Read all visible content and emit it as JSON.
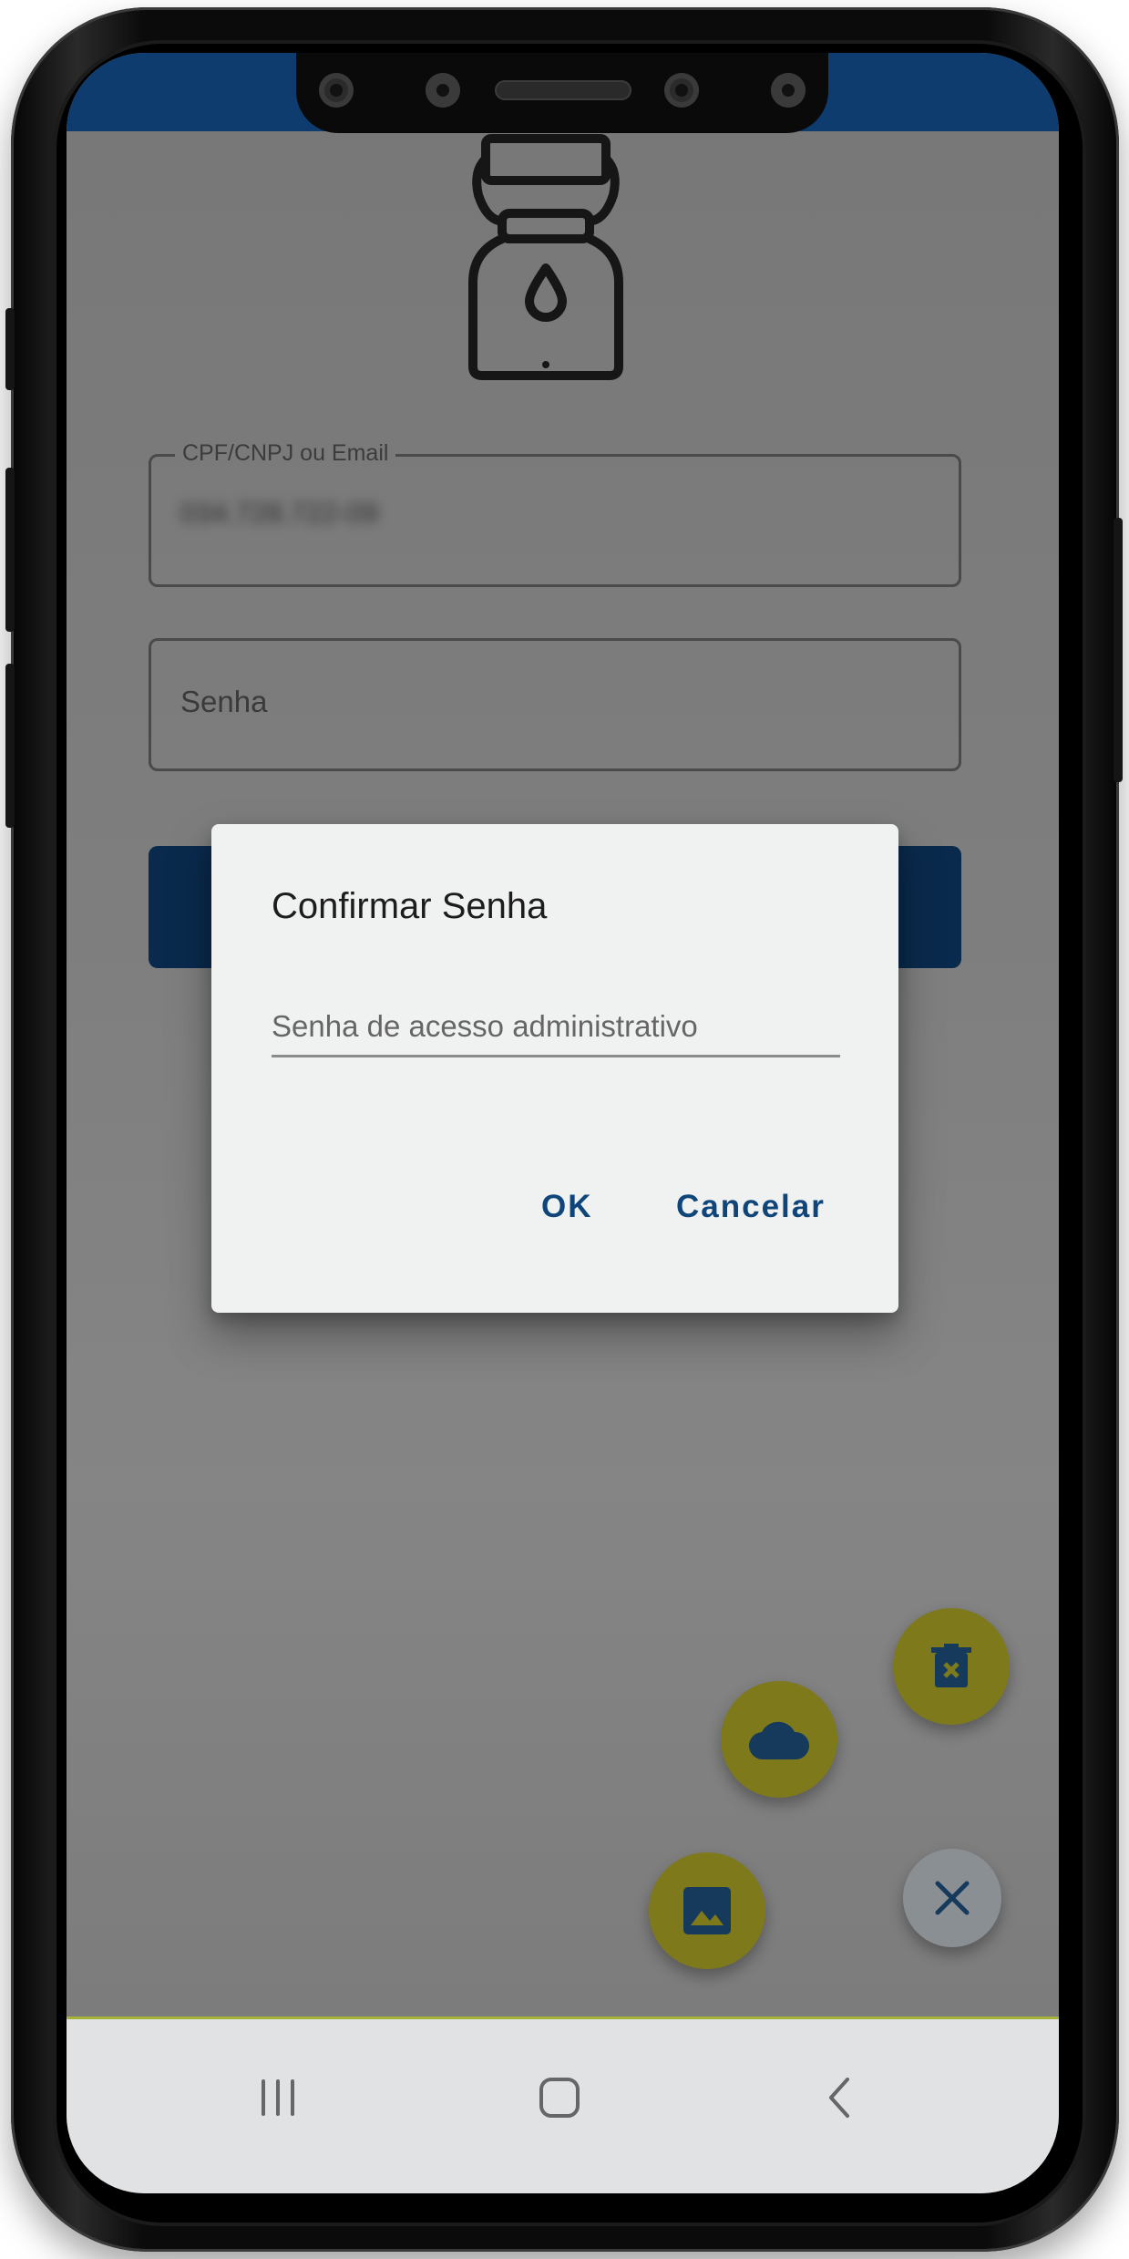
{
  "login": {
    "cpf_label": "CPF/CNPJ ou Email",
    "cpf_value": "034.728.722-09",
    "password_placeholder": "Senha"
  },
  "dialog": {
    "title": "Confirmar Senha",
    "input_placeholder": "Senha de acesso administrativo",
    "ok_label": "OK",
    "cancel_label": "Cancelar"
  },
  "fabs": {
    "delete_icon": "delete-x-icon",
    "cloud_icon": "cloud-icon",
    "image_icon": "image-icon",
    "close_icon": "close-icon"
  },
  "nav": {
    "recents_icon": "recents-icon",
    "home_icon": "home-icon",
    "back_icon": "back-icon"
  },
  "colors": {
    "primary": "#0f3c6e",
    "accent_fab": "#b5b327",
    "dialog_button": "#0f4579"
  }
}
